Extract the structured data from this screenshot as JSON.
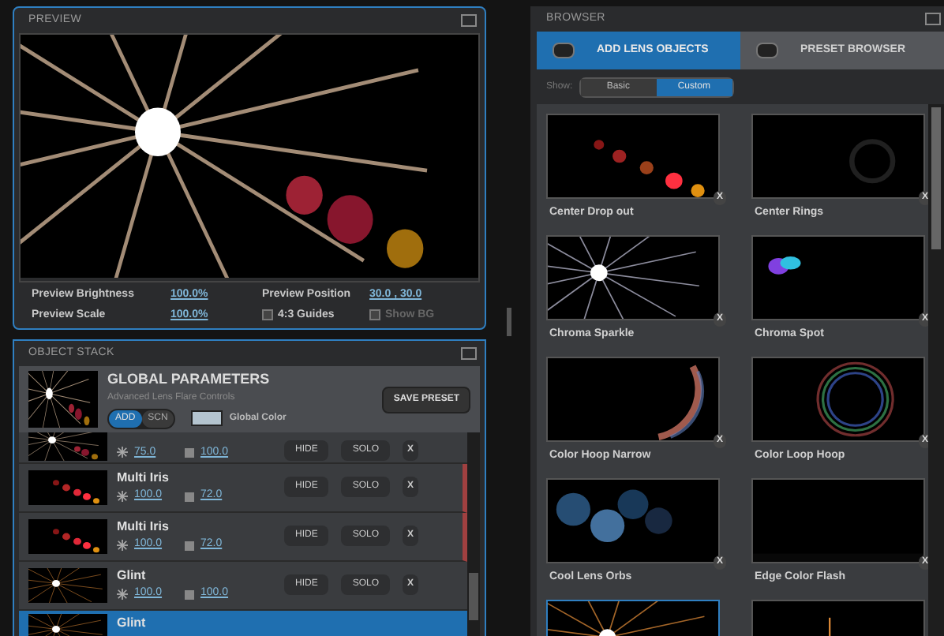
{
  "preview": {
    "title": "PREVIEW",
    "settings": [
      {
        "kind": "value",
        "label": "Preview Brightness",
        "value": "100.0%"
      },
      {
        "kind": "value",
        "label": "Preview Position",
        "value": "30.0 , 30.0"
      },
      {
        "kind": "value",
        "label": "Preview Scale",
        "value": "100.0%"
      },
      {
        "kind": "checkbox",
        "label": "4:3 Guides",
        "checked": false,
        "disabled": false
      },
      {
        "kind": "checkbox",
        "label": "Show BG",
        "checked": false,
        "disabled": true
      }
    ]
  },
  "object_stack": {
    "title": "OBJECT STACK",
    "global": {
      "title": "GLOBAL PARAMETERS",
      "subtitle": "Advanced Lens Flare Controls",
      "modes": [
        {
          "label": "ADD",
          "selected": true
        },
        {
          "label": "SCN",
          "selected": false
        }
      ],
      "color_label": "Global Color",
      "color": "#b4c4cf",
      "save": "SAVE PRESET"
    },
    "objects": [
      {
        "brightness": "75.0",
        "scale": "100.0",
        "hide": "HIDE",
        "solo": "SOLO",
        "remove": "X",
        "grouped": false,
        "selected": false
      },
      {
        "name": "Multi Iris",
        "brightness": "100.0",
        "scale": "72.0",
        "hide": "HIDE",
        "solo": "SOLO",
        "remove": "X",
        "grouped": true,
        "selected": false
      },
      {
        "name": "Multi Iris",
        "brightness": "100.0",
        "scale": "72.0",
        "hide": "HIDE",
        "solo": "SOLO",
        "remove": "X",
        "grouped": true,
        "selected": false
      },
      {
        "name": "Glint",
        "brightness": "100.0",
        "scale": "100.0",
        "hide": "HIDE",
        "solo": "SOLO",
        "remove": "X",
        "grouped": false,
        "selected": false
      },
      {
        "name": "Glint",
        "grouped": false,
        "selected": true
      }
    ]
  },
  "browser": {
    "title": "BROWSER",
    "tabs": [
      {
        "label": "ADD LENS OBJECTS",
        "selected": true
      },
      {
        "label": "PRESET BROWSER",
        "selected": false
      }
    ],
    "show_label": "Show:",
    "filters": [
      {
        "label": "Basic",
        "selected": false
      },
      {
        "label": "Custom",
        "selected": true
      }
    ],
    "items": [
      {
        "name": "Center Drop out",
        "remove": "X",
        "selected": false
      },
      {
        "name": "Center Rings",
        "remove": "X",
        "selected": false
      },
      {
        "name": "Chroma Sparkle",
        "remove": "X",
        "selected": false
      },
      {
        "name": "Chroma Spot",
        "remove": "X",
        "selected": false
      },
      {
        "name": "Color Hoop Narrow",
        "remove": "X",
        "selected": false
      },
      {
        "name": "Color Loop Hoop",
        "remove": "X",
        "selected": false
      },
      {
        "name": "Cool Lens Orbs",
        "remove": "X",
        "selected": false
      },
      {
        "name": "Edge Color Flash",
        "remove": "X",
        "selected": false
      },
      {
        "selected": true
      },
      {
        "selected": false
      }
    ]
  }
}
